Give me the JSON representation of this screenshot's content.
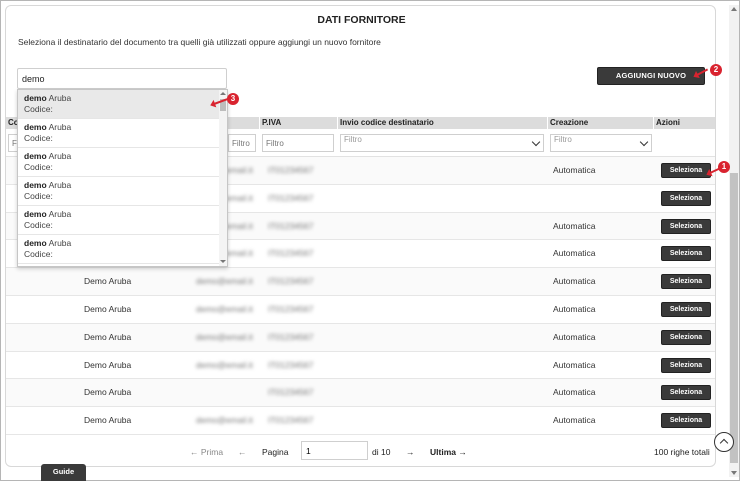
{
  "dialog": {
    "title": "DATI FORNITORE",
    "subtitle": "Seleziona il destinatario del documento tra quelli già utilizzati oppure aggiungi un nuovo fornitore",
    "search_value": "demo",
    "add_button": "AGGIUNGI NUOVO"
  },
  "markers": {
    "m1": "1",
    "m2": "2",
    "m3": "3"
  },
  "columns": {
    "codice": "Co",
    "piva": "P.IVA",
    "invio": "Invio codice destinatario",
    "creazione": "Creazione",
    "azioni": "Azioni"
  },
  "filter_placeholder": "Filtro",
  "suggestions": [
    {
      "match": "demo",
      "rest": " Aruba",
      "code_label": "Codice:"
    },
    {
      "match": "demo",
      "rest": " Aruba",
      "code_label": "Codice:"
    },
    {
      "match": "demo",
      "rest": " Aruba",
      "code_label": "Codice:"
    },
    {
      "match": "demo",
      "rest": " Aruba",
      "code_label": "Codice:"
    },
    {
      "match": "demo",
      "rest": " Aruba",
      "code_label": "Codice:"
    },
    {
      "match": "demo",
      "rest": " Aruba",
      "code_label": "Codice:"
    }
  ],
  "rows": [
    {
      "name": "",
      "email": "demo@email.it",
      "piva": "IT01234567",
      "creazione": "Automatica",
      "action": "Seleziona"
    },
    {
      "name": "",
      "email": "demo@email.it",
      "piva": "IT01234567",
      "creazione": "",
      "action": "Seleziona"
    },
    {
      "name": "",
      "email": "demo@email.it",
      "piva": "IT01234567",
      "creazione": "Automatica",
      "action": "Seleziona"
    },
    {
      "name": "",
      "email": "demo@email.it",
      "piva": "IT01234567",
      "creazione": "Automatica",
      "action": "Seleziona"
    },
    {
      "name": "Demo Aruba",
      "email": "demo@email.it",
      "piva": "IT01234567",
      "creazione": "Automatica",
      "action": "Seleziona"
    },
    {
      "name": "Demo Aruba",
      "email": "demo@email.it",
      "piva": "IT01234567",
      "creazione": "Automatica",
      "action": "Seleziona"
    },
    {
      "name": "Demo Aruba",
      "email": "demo@email.it",
      "piva": "IT01234567",
      "creazione": "Automatica",
      "action": "Seleziona"
    },
    {
      "name": "Demo Aruba",
      "email": "demo@email.it",
      "piva": "IT01234567",
      "creazione": "Automatica",
      "action": "Seleziona"
    },
    {
      "name": "Demo Aruba",
      "email": "",
      "piva": "IT01234567",
      "creazione": "Automatica",
      "action": "Seleziona"
    },
    {
      "name": "Demo Aruba",
      "email": "demo@email.it",
      "piva": "IT01234567",
      "creazione": "Automatica",
      "action": "Seleziona"
    }
  ],
  "pagination": {
    "first": "← Prima",
    "prev": "←",
    "page_label": "Pagina",
    "page_value": "1",
    "of": "di 10",
    "next": "→",
    "last": "Ultima →",
    "total": "100 righe totali"
  },
  "guide_button": "Guide",
  "colors": {
    "accent": "#d9232f",
    "button": "#3a3a3a"
  }
}
